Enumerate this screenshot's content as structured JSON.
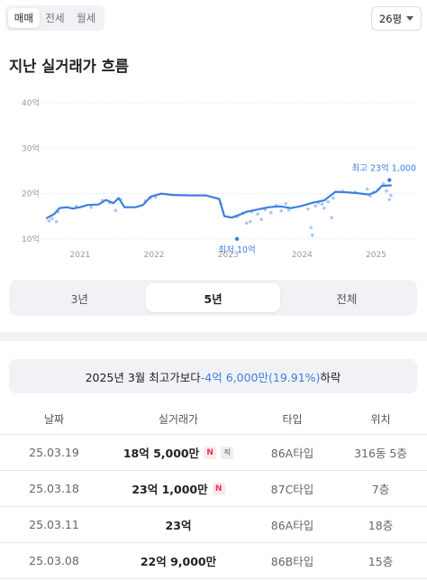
{
  "deal_tabs": [
    {
      "label": "매매",
      "active": true
    },
    {
      "label": "전세",
      "active": false
    },
    {
      "label": "월세",
      "active": false
    }
  ],
  "size_select": {
    "value": "26평"
  },
  "title": "지난 실거래가 흐름",
  "colors": {
    "accent": "#3d7fe0",
    "scatter": "#a9c8f3",
    "grid": "#e9ebee",
    "new_badge": "#e0395a"
  },
  "chart_data": {
    "type": "line",
    "ylim": [
      5,
      42
    ],
    "xlim": [
      2020.55,
      2025.25
    ],
    "y_ticks": [
      {
        "v": 10,
        "label": "10억"
      },
      {
        "v": 20,
        "label": "20억"
      },
      {
        "v": 30,
        "label": "30억"
      },
      {
        "v": 40,
        "label": "40억"
      }
    ],
    "x_ticks": [
      {
        "v": 2021,
        "label": "2021"
      },
      {
        "v": 2022,
        "label": "2022"
      },
      {
        "v": 2023,
        "label": "2023"
      },
      {
        "v": 2024,
        "label": "2024"
      },
      {
        "v": 2025,
        "label": "2025"
      }
    ],
    "series": [
      {
        "values": [
          [
            2020.55,
            14.6
          ],
          [
            2020.65,
            15.5
          ],
          [
            2020.72,
            16.8
          ],
          [
            2020.82,
            17.0
          ],
          [
            2020.9,
            16.7
          ],
          [
            2021.0,
            17.0
          ],
          [
            2021.1,
            17.5
          ],
          [
            2021.25,
            17.6
          ],
          [
            2021.35,
            18.6
          ],
          [
            2021.45,
            17.9
          ],
          [
            2021.52,
            19.0
          ],
          [
            2021.6,
            17.0
          ],
          [
            2021.75,
            17.0
          ],
          [
            2021.85,
            17.5
          ],
          [
            2021.95,
            19.3
          ],
          [
            2022.1,
            20.0
          ],
          [
            2022.25,
            19.7
          ],
          [
            2022.5,
            19.6
          ],
          [
            2022.7,
            19.6
          ],
          [
            2022.88,
            18.8
          ],
          [
            2022.95,
            15.0
          ],
          [
            2023.05,
            14.7
          ],
          [
            2023.15,
            15.3
          ],
          [
            2023.25,
            16.0
          ],
          [
            2023.4,
            16.5
          ],
          [
            2023.55,
            17.0
          ],
          [
            2023.7,
            17.2
          ],
          [
            2023.85,
            16.8
          ],
          [
            2024.0,
            17.3
          ],
          [
            2024.15,
            18.0
          ],
          [
            2024.3,
            18.5
          ],
          [
            2024.45,
            20.4
          ],
          [
            2024.6,
            20.3
          ],
          [
            2024.75,
            20.1
          ],
          [
            2024.9,
            19.8
          ],
          [
            2025.0,
            20.4
          ],
          [
            2025.08,
            21.7
          ],
          [
            2025.2,
            21.8
          ]
        ]
      }
    ],
    "scatter": [
      [
        2020.58,
        14.0
      ],
      [
        2020.62,
        14.5
      ],
      [
        2020.68,
        13.8
      ],
      [
        2020.7,
        16.0
      ],
      [
        2020.95,
        17.2
      ],
      [
        2021.15,
        17.0
      ],
      [
        2021.3,
        18.5
      ],
      [
        2021.4,
        18.0
      ],
      [
        2021.48,
        16.3
      ],
      [
        2021.55,
        18.7
      ],
      [
        2021.88,
        18.4
      ],
      [
        2021.95,
        19.0
      ],
      [
        2022.02,
        19.2
      ],
      [
        2022.9,
        17.8
      ],
      [
        2023.12,
        14.9
      ],
      [
        2023.2,
        15.7
      ],
      [
        2023.25,
        13.5
      ],
      [
        2023.3,
        13.8
      ],
      [
        2023.32,
        16.0
      ],
      [
        2023.4,
        15.5
      ],
      [
        2023.45,
        14.3
      ],
      [
        2023.5,
        16.5
      ],
      [
        2023.58,
        15.8
      ],
      [
        2023.65,
        17.4
      ],
      [
        2023.72,
        16.2
      ],
      [
        2023.78,
        17.8
      ],
      [
        2023.82,
        16.4
      ],
      [
        2024.08,
        16.6
      ],
      [
        2024.12,
        12.5
      ],
      [
        2024.14,
        10.8
      ],
      [
        2024.18,
        17.3
      ],
      [
        2024.22,
        18.0
      ],
      [
        2024.27,
        17.7
      ],
      [
        2024.3,
        16.8
      ],
      [
        2024.35,
        18.2
      ],
      [
        2024.4,
        14.7
      ],
      [
        2024.42,
        19.0
      ],
      [
        2024.55,
        20.5
      ],
      [
        2024.72,
        20.3
      ],
      [
        2024.88,
        21.0
      ],
      [
        2024.92,
        19.5
      ],
      [
        2024.97,
        20.3
      ],
      [
        2025.03,
        20.9
      ],
      [
        2025.1,
        22.2
      ],
      [
        2025.14,
        20.6
      ],
      [
        2025.18,
        18.7
      ],
      [
        2025.2,
        19.6
      ]
    ],
    "highlight_points": [
      {
        "x": 2023.12,
        "y": 10.0,
        "label": "최저 10억",
        "position": "below"
      },
      {
        "x": 2025.18,
        "y": 23.0,
        "label": "최고 23억 1,000",
        "position": "above"
      }
    ]
  },
  "period_tabs": [
    {
      "label": "3년",
      "active": false
    },
    {
      "label": "5년",
      "active": true
    },
    {
      "label": "전체",
      "active": false
    }
  ],
  "summary": {
    "prefix": "2025년 3월 최고가보다 ",
    "diff": "-4억 6,000만(19.91%)",
    "suffix": " 하락"
  },
  "table": {
    "headers": {
      "date": "날짜",
      "price": "실거래가",
      "type": "타입",
      "floor": "위치"
    },
    "rows": [
      {
        "date": "25.03.19",
        "price": "18억 5,000만",
        "new": "N",
        "direct": "직",
        "type": "86A타입",
        "floor": "316동 5층"
      },
      {
        "date": "25.03.18",
        "price": "23억 1,000만",
        "new": "N",
        "direct": "",
        "type": "87C타입",
        "floor": "7층"
      },
      {
        "date": "25.03.11",
        "price": "23억",
        "new": "",
        "direct": "",
        "type": "86A타입",
        "floor": "18층"
      },
      {
        "date": "25.03.08",
        "price": "22억 9,000만",
        "new": "",
        "direct": "",
        "type": "86B타입",
        "floor": "15층"
      }
    ]
  }
}
